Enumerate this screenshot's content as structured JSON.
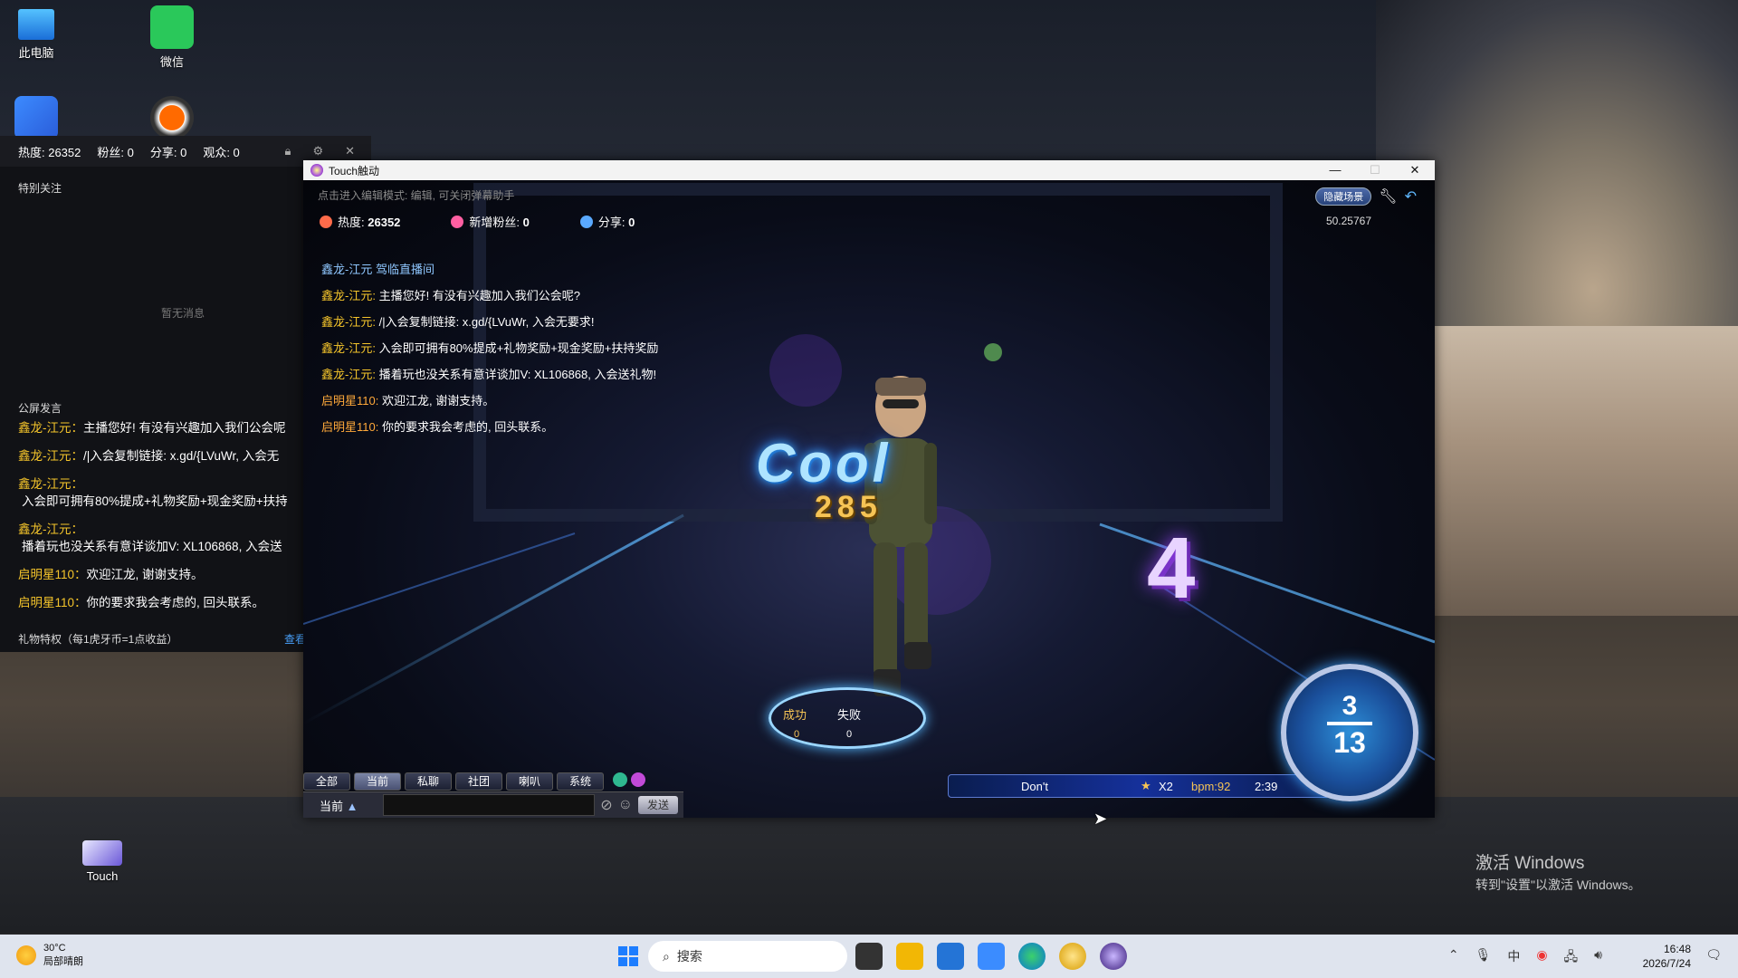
{
  "desktop": {
    "icons": [
      {
        "label": "此电脑"
      },
      {
        "label": "微信"
      },
      {
        "label": ""
      },
      {
        "label": ""
      },
      {
        "label": "Touch"
      }
    ],
    "activation": {
      "title": "激活 Windows",
      "subtitle": "转到\"设置\"以激活 Windows。"
    }
  },
  "stream_panel": {
    "stats": {
      "heat": "热度: 26352",
      "fans": "粉丝: 0",
      "shares": "分享: 0",
      "viewers": "观众: 0"
    },
    "special_follow": "特别关注",
    "no_messages": "暂无消息",
    "public_chat_title": "公屏发言",
    "chat": [
      {
        "name": "鑫龙-江元：",
        "text": "主播您好! 有没有兴趣加入我们公会呢"
      },
      {
        "name": "鑫龙-江元：",
        "text": "/|入会复制链接: x.gd/{LVuWr, 入会无"
      },
      {
        "name": "鑫龙-江元：",
        "text": ""
      },
      {
        "name": "",
        "text": "入会即可拥有80%提成+礼物奖励+现金奖励+扶持"
      },
      {
        "name": "鑫龙-江元：",
        "text": ""
      },
      {
        "name": "",
        "text": "播着玩也没关系有意详谈加V: XL106868, 入会送"
      },
      {
        "name": "启明星110：",
        "text": "欢迎江龙, 谢谢支持。"
      },
      {
        "name": "启明星110：",
        "text": "你的要求我会考虑的, 回头联系。"
      }
    ],
    "gift_privilege": "礼物特权（每1虎牙币=1点收益）",
    "view_link": "查看"
  },
  "game_window": {
    "title": "Touch触动",
    "hint": "点击进入编辑模式: 编辑, 可关闭弹幕助手",
    "stats": {
      "heat_label": "热度:",
      "heat_value": "26352",
      "fans_label": "新增粉丝:",
      "fans_value": "0",
      "share_label": "分享:",
      "share_value": "0"
    },
    "hide_scene": "隐藏场景",
    "timer_value": "50.25767",
    "chat": [
      {
        "name": "鑫龙-江元 驾临直播间",
        "text": "",
        "type": "sys"
      },
      {
        "name": "鑫龙-江元:",
        "text": "主播您好! 有没有兴趣加入我们公会呢?",
        "type": "user"
      },
      {
        "name": "鑫龙-江元:",
        "text": "/|入会复制链接: x.gd/{LVuWr, 入会无要求!",
        "type": "user"
      },
      {
        "name": "鑫龙-江元:",
        "text": "入会即可拥有80%提成+礼物奖励+现金奖励+扶持奖励",
        "type": "user"
      },
      {
        "name": "鑫龙-江元:",
        "text": "播着玩也没关系有意详谈加V: XL106868, 入会送礼物!",
        "type": "user"
      },
      {
        "name": "启明星110:",
        "text": "欢迎江龙, 谢谢支持。",
        "type": "host"
      },
      {
        "name": "启明星110:",
        "text": "你的要求我会考虑的, 回头联系。",
        "type": "host"
      }
    ],
    "judgement": "Cool",
    "combo": "285",
    "beat_count": "4",
    "ring": {
      "success_label": "成功",
      "fail_label": "失败",
      "success_count": "0",
      "fail_count": "0"
    },
    "tabs": [
      "全部",
      "当前",
      "私聊",
      "社团",
      "喇叭",
      "系统"
    ],
    "active_tab": "当前",
    "chat_channel": "当前",
    "send_label": "发送",
    "song": {
      "name": "Don't",
      "multiplier": "X2",
      "bpm": "bpm:92",
      "time": "2:39"
    },
    "progress": {
      "current": "3",
      "total": "13"
    }
  },
  "taskbar": {
    "weather_temp": "30°C",
    "weather_desc": "局部晴朗",
    "search_placeholder": "搜索",
    "time": "16:48",
    "date": "2026/7/24"
  },
  "colors": {
    "accent": "#f5c52b",
    "system": "#8fc7ff",
    "taskbar": "#dfe4ee"
  }
}
